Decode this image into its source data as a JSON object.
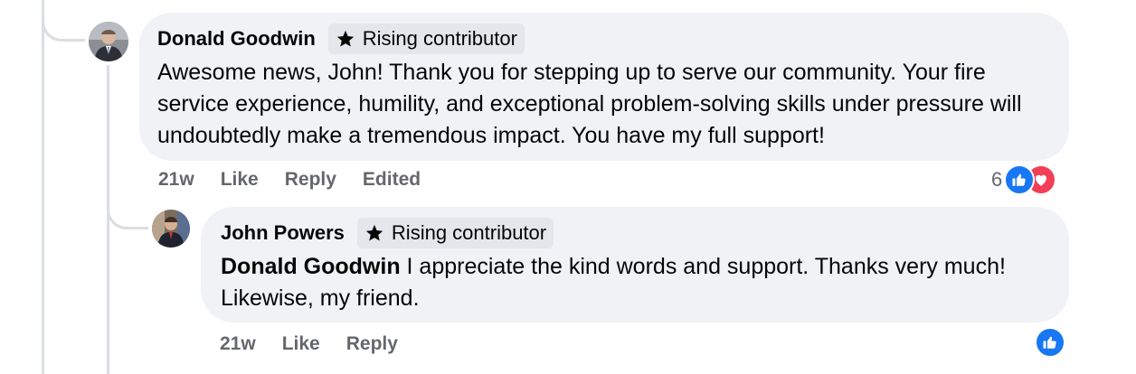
{
  "comment": {
    "author": "Donald Goodwin",
    "badge": "Rising contributor",
    "text": "Awesome news, John! Thank you for stepping up to serve our community. Your fire service experience, humility, and exceptional problem-solving skills under pressure will undoubtedly make a tremendous impact. You have my full support!",
    "time": "21w",
    "like_label": "Like",
    "reply_label": "Reply",
    "edited_label": "Edited",
    "reaction_count": "6",
    "reactions": [
      "like-icon",
      "love-icon"
    ]
  },
  "reply": {
    "author": "John Powers",
    "badge": "Rising contributor",
    "mention": "Donald Goodwin",
    "text": " I appreciate the kind words and support. Thanks very much! Likewise, my friend.",
    "time": "21w",
    "like_label": "Like",
    "reply_label": "Reply",
    "reactions": [
      "like-icon"
    ]
  },
  "colors": {
    "like_blue": "#1877f2",
    "love_red": "#f33e58",
    "bubble": "#f0f2f5",
    "secondary_text": "#65676b"
  }
}
